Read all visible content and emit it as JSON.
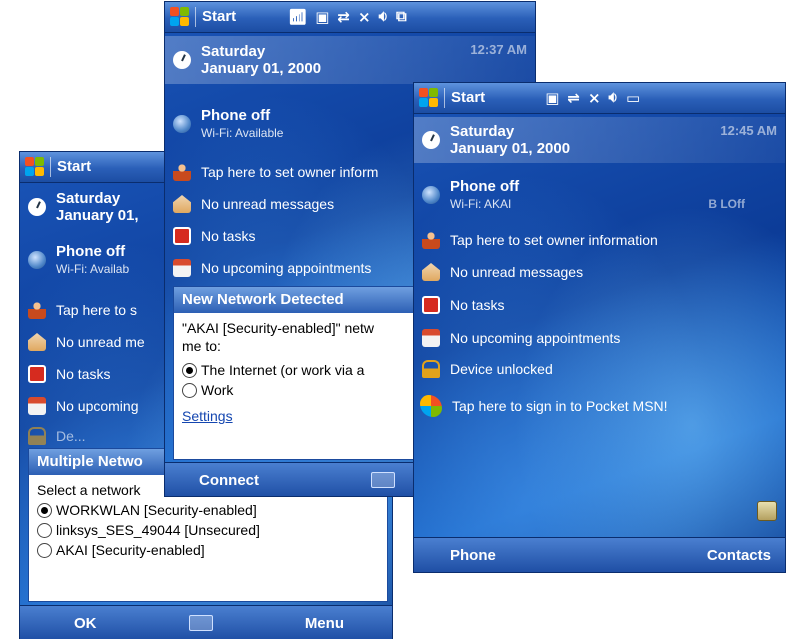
{
  "screen_left": {
    "start": "Start",
    "rows": [
      {
        "line1": "Saturday",
        "line2": "January 01,"
      },
      {
        "line1": "Phone off",
        "line2": "Wi-Fi: Availab"
      },
      {
        "line1": "Tap here to s"
      },
      {
        "line1": "No unread me"
      },
      {
        "line1": "No tasks"
      },
      {
        "line1": "No upcoming"
      },
      {
        "line1": "De..."
      }
    ],
    "dialog": {
      "title": "Multiple Netwo",
      "prompt": "Select a network",
      "options": [
        "WORKWLAN [Security-enabled]",
        "linksys_SES_49044 [Unsecured]",
        "AKAI [Security-enabled]"
      ],
      "selected": 0
    },
    "softkeys": {
      "left": "OK",
      "right": "Menu"
    }
  },
  "screen_middle": {
    "start": "Start",
    "time": "12:37 AM",
    "rows": [
      {
        "line1": "Saturday",
        "line2": "January 01, 2000"
      },
      {
        "line1": "Phone off",
        "line2": "Wi-Fi: Available"
      },
      {
        "line1": "Tap here to set owner inform"
      },
      {
        "line1": "No unread messages"
      },
      {
        "line1": "No tasks"
      },
      {
        "line1": "No upcoming appointments"
      }
    ],
    "dialog": {
      "title": "New Network Detected",
      "text": "\"AKAI [Security-enabled]\" netw me to:",
      "options": [
        "The Internet (or work via a",
        "Work"
      ],
      "selected": 0,
      "link": "Settings"
    },
    "softkeys": {
      "left": "Connect"
    }
  },
  "screen_right": {
    "start": "Start",
    "time": "12:45 AM",
    "rows": [
      {
        "line1": "Saturday",
        "line2": "January 01, 2000"
      },
      {
        "line1": "Phone off",
        "line2": "Wi-Fi: AKAI",
        "extra": "B LOff"
      },
      {
        "line1": "Tap here to set owner information"
      },
      {
        "line1": "No unread messages"
      },
      {
        "line1": "No tasks"
      },
      {
        "line1": "No upcoming appointments"
      },
      {
        "line1": "Device unlocked"
      },
      {
        "line1": "Tap here to sign in to Pocket MSN!"
      }
    ],
    "softkeys": {
      "left": "Phone",
      "right": "Contacts"
    }
  }
}
